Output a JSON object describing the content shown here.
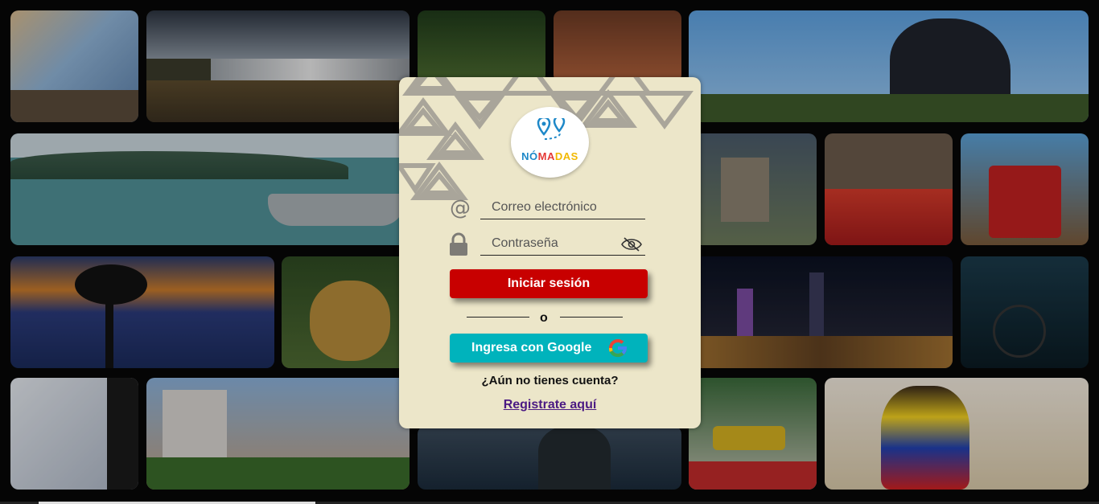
{
  "login": {
    "logo_text_blue": "NÓ",
    "logo_text_red": "MA",
    "logo_text_yellow": "DAS",
    "email_placeholder": "Correo electrónico",
    "password_placeholder": "Contraseña",
    "login_button": "Iniciar sesión",
    "divider_text": "o",
    "google_button": "Ingresa con Google",
    "no_account_text": "¿Aún no tienes cuenta?",
    "register_link": "Registrate aquí"
  },
  "icons": {
    "email": "at-icon",
    "password": "lock-icon",
    "toggle_password": "eye-slash-icon",
    "google": "google-icon"
  },
  "colors": {
    "card_background": "#ece6c9",
    "login_button": "#c80000",
    "google_button": "#00b3bc",
    "register_link": "#4b1a83"
  }
}
